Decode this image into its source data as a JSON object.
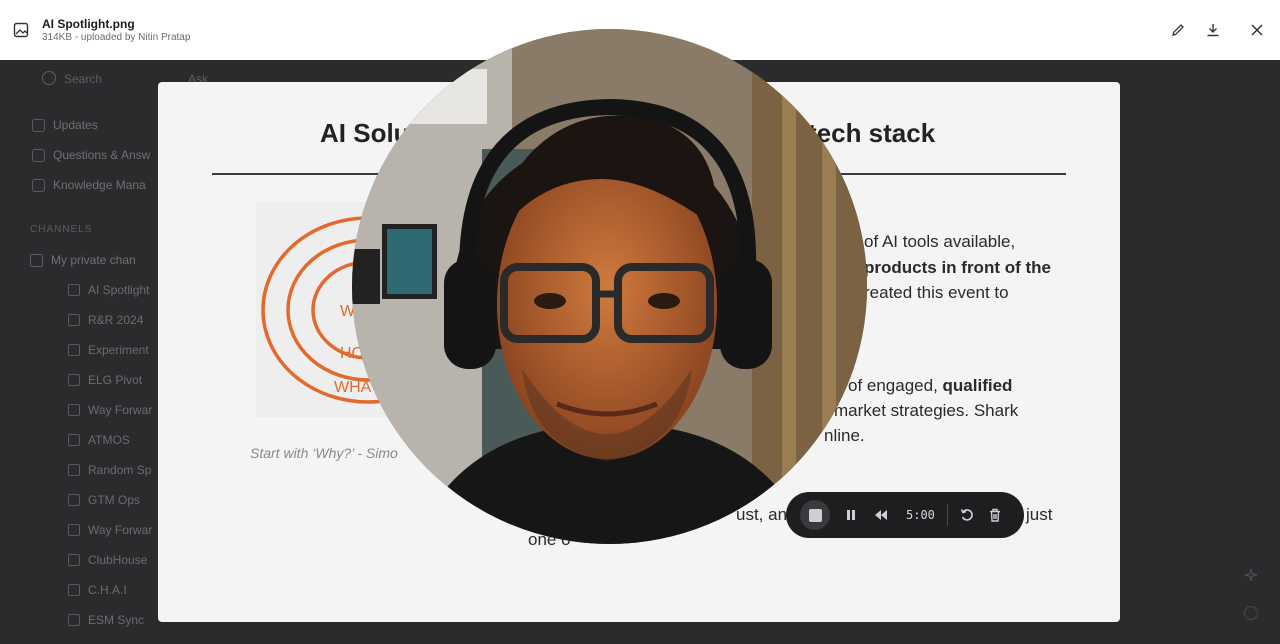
{
  "file": {
    "title": "AI Spotlight.png",
    "subtitle": "314KB - uploaded by Nitin Pratap"
  },
  "toolbar": {
    "edit_icon": "pencil-icon",
    "download_icon": "download-icon",
    "close_icon": "close-icon"
  },
  "background_app": {
    "search_label": "Search",
    "ask_label": "Ask",
    "nav": [
      "Updates",
      "Questions & Answ",
      "Knowledge Mana"
    ],
    "channels_heading": "CHANNELS",
    "private_channel": "My private chan",
    "channels": [
      "AI Spotlight",
      "R&R 2024",
      "Experiment",
      "ELG Pivot",
      "Way Forwar",
      "ATMOS",
      "Random Sp",
      "GTM Ops",
      "Way Forwar",
      "ClubHouse",
      "C.H.A.I",
      "ESM Sync"
    ]
  },
  "slide": {
    "title_left": "AI Solu",
    "title_right": "tech stack",
    "image_words": [
      "W",
      "HO",
      "WHA"
    ],
    "caption": "Start with ‘Why?’ - Simo",
    "lines": [
      {
        "text": "of AI tools available,",
        "bold": ""
      },
      {
        "text": "",
        "bold": "products in front of the"
      },
      {
        "text": "reated this event to",
        "bold": ""
      },
      {
        "text": "of engaged, ",
        "bold": "qualified"
      },
      {
        "text": "market strategies. Shark",
        "bold": ""
      },
      {
        "text": "nline.",
        "bold": ""
      },
      {
        "text": "ust, and",
        "bold": ""
      },
      {
        "text": "just",
        "bold": ""
      },
      {
        "text": "one o",
        "bold": ""
      }
    ]
  },
  "recorder": {
    "timer": "5:00",
    "stop_icon": "stop-icon",
    "pause_icon": "pause-icon",
    "rewind_icon": "rewind-icon",
    "restart_icon": "restart-icon",
    "delete_icon": "trash-icon"
  }
}
